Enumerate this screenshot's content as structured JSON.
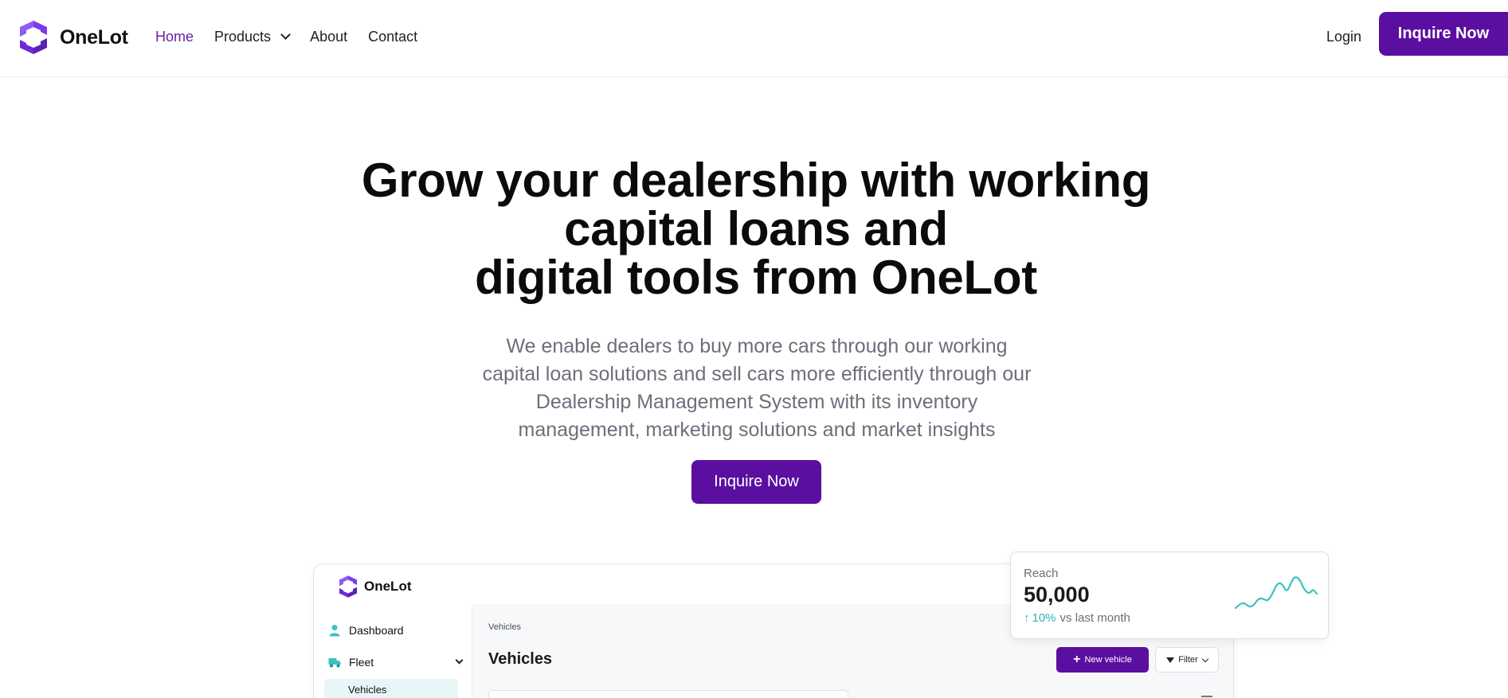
{
  "brand": {
    "name": "OneLot",
    "accent": "#5b0fa0",
    "link_active": "#6b21a8"
  },
  "nav": {
    "links": [
      "Home",
      "Products",
      "About",
      "Contact"
    ],
    "login": "Login",
    "cta": "Inquire Now"
  },
  "hero": {
    "title_lines": [
      "Grow your dealership with working",
      "capital loans and",
      "digital tools from OneLot"
    ],
    "subtitle_lines": [
      "We enable dealers to buy more cars through our working",
      "capital loan solutions and sell cars more efficiently through our",
      "Dealership Management System with its inventory",
      "management, marketing solutions and market insights"
    ],
    "cta": "Inquire Now"
  },
  "app_preview": {
    "logo": "OneLot",
    "sidebar": [
      {
        "label": "Dashboard",
        "icon": "user-icon"
      },
      {
        "label": "Fleet",
        "icon": "truck-icon"
      },
      {
        "label": "Vehicles",
        "icon": ""
      }
    ],
    "breadcrumb": "Vehicles",
    "page_title": "Vehicles",
    "new_vehicle": "New vehicle",
    "filter": "Filter"
  },
  "reach_card": {
    "label": "Reach",
    "value": "50,000",
    "delta_pct": "10%",
    "delta_text": "vs last month",
    "trend_color": "#2bb7b3"
  }
}
